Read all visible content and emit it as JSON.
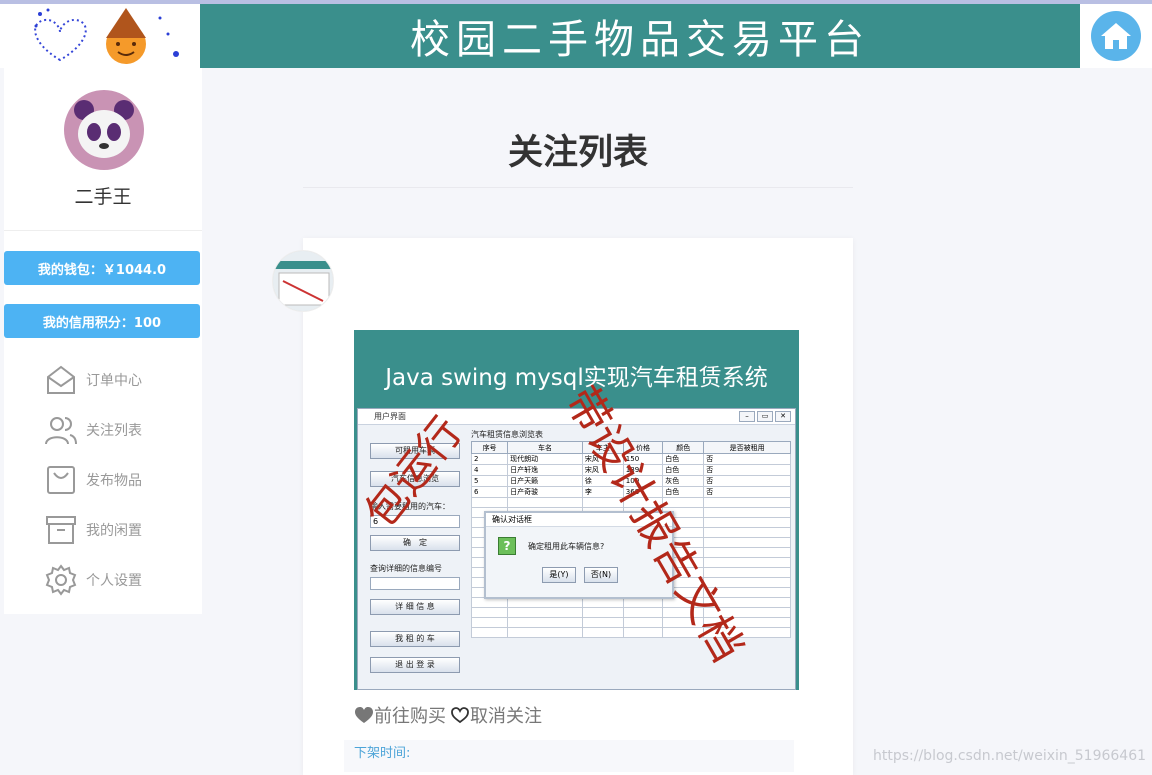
{
  "header": {
    "title": "校园二手物品交易平台",
    "home_icon": "home-icon",
    "banner_color": "#3a8f8c",
    "home_color": "#5ab4ea"
  },
  "sidebar": {
    "username": "二手王",
    "wallet": "我的钱包：￥1044.0",
    "credit": "我的信用积分：100",
    "pill_color": "#4db3f3",
    "items": [
      {
        "label": "订单中心",
        "icon": "envelope-icon"
      },
      {
        "label": "关注列表",
        "icon": "users-icon"
      },
      {
        "label": "发布物品",
        "icon": "bag-icon"
      },
      {
        "label": "我的闲置",
        "icon": "archive-icon"
      },
      {
        "label": "个人设置",
        "icon": "gear-icon"
      }
    ]
  },
  "main": {
    "title": "关注列表",
    "card": {
      "product_image": {
        "heading": "Java swing mysql实现汽车租赁系统",
        "window_title": "用户界面",
        "buttons": [
          "可租用车辆",
          "汽车信息浏览",
          "确　定",
          "详 细 信 息",
          "我 租 的 车",
          "退 出 登 录"
        ],
        "prompt_rent": "输入需要租用的汽车：",
        "rent_value": "6",
        "prompt_detail": "查询详细的信息编号",
        "table_title": "汽车租赁信息浏览表",
        "columns": [
          "序号",
          "车名",
          "车主",
          "价格",
          "颜色",
          "是否被租用"
        ],
        "rows": [
          [
            "2",
            "现代朗动",
            "宋风",
            "150",
            "白色",
            "否"
          ],
          [
            "4",
            "日产轩逸",
            "宋风",
            "189",
            "白色",
            "否"
          ],
          [
            "5",
            "日产天籁",
            "徐",
            "100",
            "灰色",
            "否"
          ],
          [
            "6",
            "日产奇骏",
            "李",
            "368",
            "白色",
            "否"
          ]
        ],
        "dialog": {
          "title": "确认对话框",
          "message": "确定租用此车辆信息?",
          "yes": "是(Y)",
          "no": "否(N)"
        },
        "watermark_1": "包运行",
        "watermark_2": "带设计报告文档"
      },
      "buy_label": "前往购买",
      "unfollow_label": "取消关注",
      "offshelf_label": "下架时间:"
    }
  },
  "footer_credit": "https://blog.csdn.net/weixin_51966461"
}
